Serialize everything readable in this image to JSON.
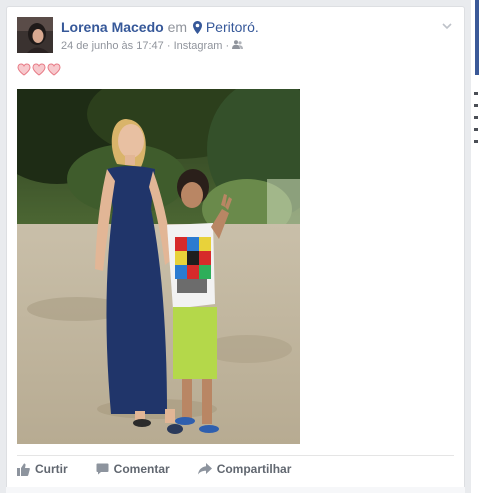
{
  "post": {
    "author": "Lorena Macedo",
    "connector": "em",
    "location": "Peritoró.",
    "date": "24 de junho às 17:47",
    "separator": "·",
    "app": "Instagram",
    "audience_icon": "friends-icon",
    "location_icon": "map-pin-icon",
    "options_icon": "chevron-down-icon",
    "reaction_emojis": [
      "heart-emoji",
      "heart-emoji",
      "heart-emoji"
    ],
    "image": "photo of a woman in a long navy dress standing next to a child making a peace sign outdoors"
  },
  "actions": {
    "like_label": "Curtir",
    "comment_label": "Comentar",
    "share_label": "Compartilhar",
    "like_icon": "thumbs-up-icon",
    "comment_icon": "comment-bubble-icon",
    "share_icon": "share-arrow-icon"
  },
  "colors": {
    "link": "#365899",
    "secondary_text": "#90949c",
    "action_text": "#616770",
    "page_bg": "#e9ebee",
    "brand": "#3b5998"
  }
}
